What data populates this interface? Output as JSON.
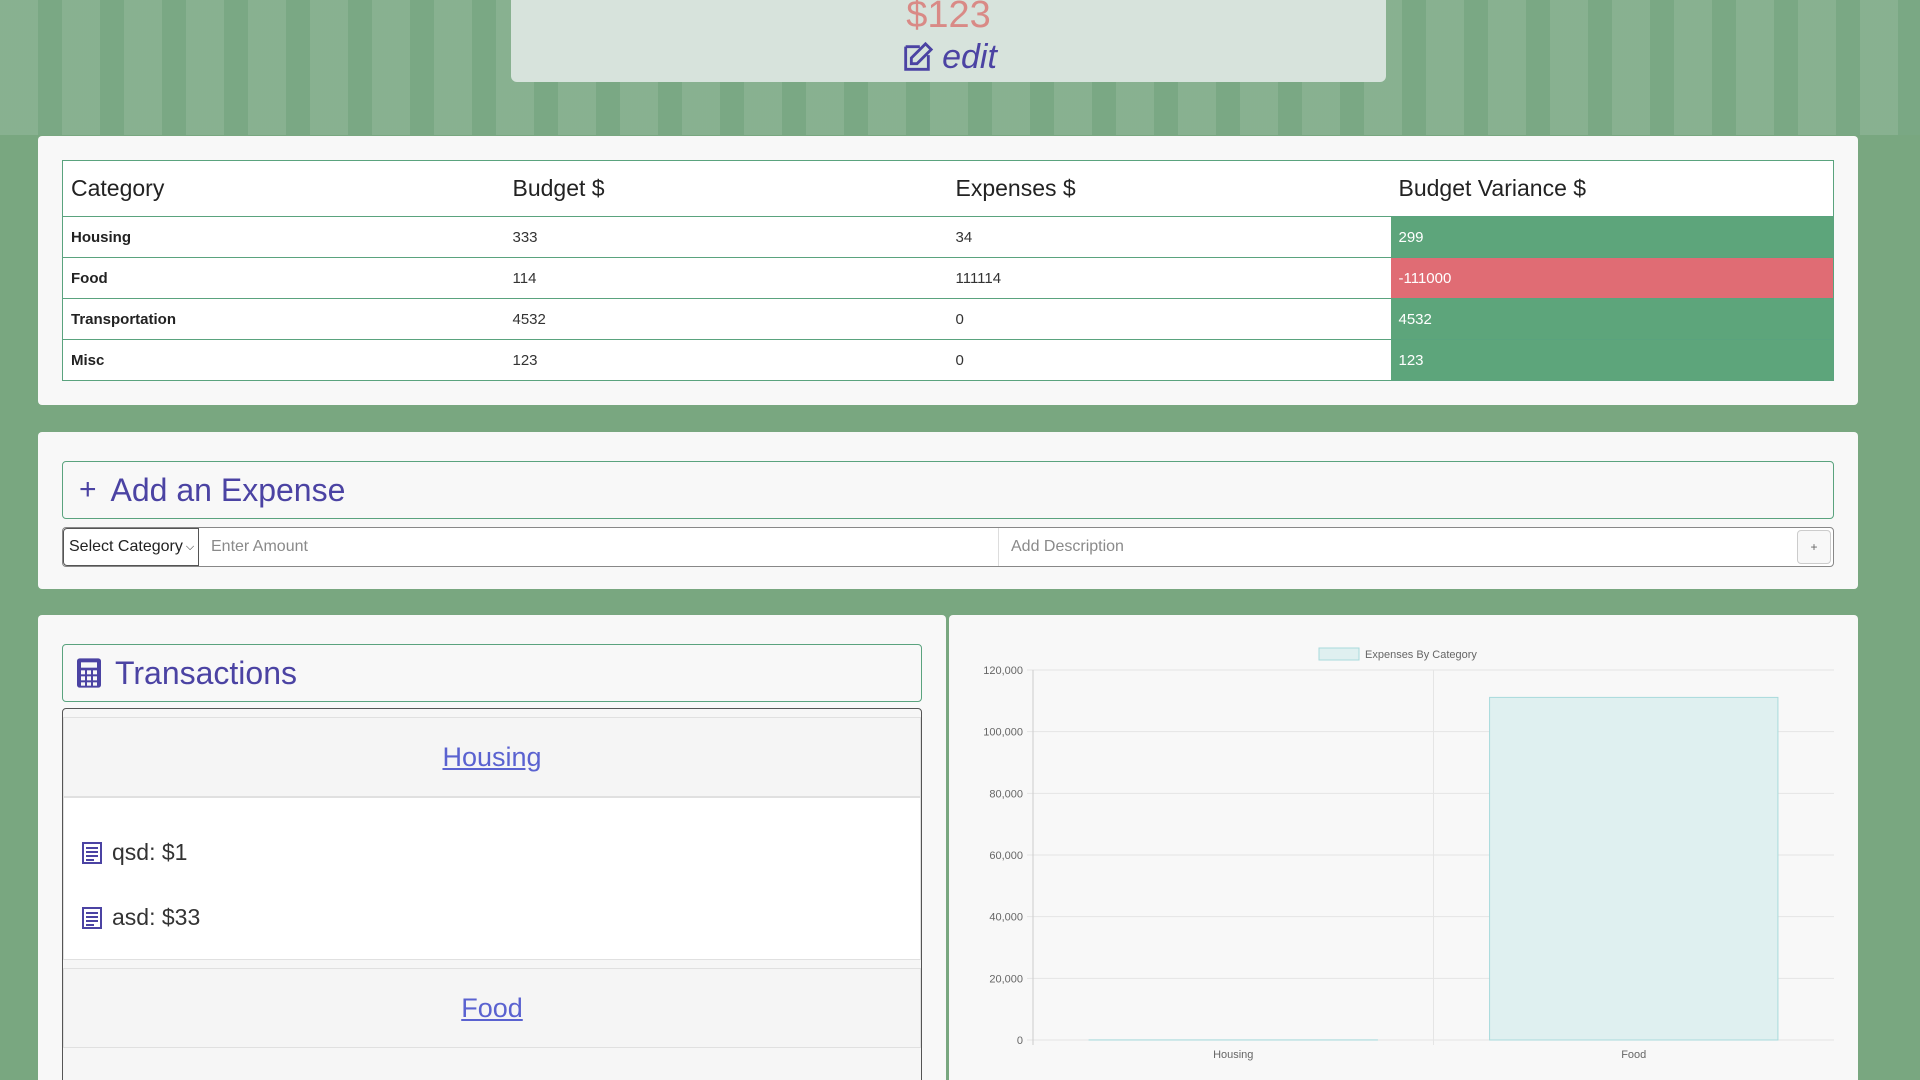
{
  "summary": {
    "budget_amount": "$123",
    "edit_label": "edit"
  },
  "budget_table": {
    "headers": [
      "Category",
      "Budget $",
      "Expenses $",
      "Budget Variance $"
    ],
    "rows": [
      {
        "category": "Housing",
        "budget": "333",
        "expenses": "34",
        "variance": "299",
        "status": "positive"
      },
      {
        "category": "Food",
        "budget": "114",
        "expenses": "111114",
        "variance": "-111000",
        "status": "negative"
      },
      {
        "category": "Transportation",
        "budget": "4532",
        "expenses": "0",
        "variance": "4532",
        "status": "positive"
      },
      {
        "category": "Misc",
        "budget": "123",
        "expenses": "0",
        "variance": "123",
        "status": "positive"
      }
    ]
  },
  "add_expense": {
    "title": "Add an Expense",
    "select_label": "Select Category",
    "amount_placeholder": "Enter Amount",
    "description_placeholder": "Add Description",
    "add_button": "+"
  },
  "transactions": {
    "title": "Transactions",
    "groups": [
      {
        "name": "Housing",
        "items": [
          "qsd: $1",
          "asd: $33"
        ]
      },
      {
        "name": "Food",
        "items": []
      }
    ]
  },
  "colors": {
    "positive": "#5da57b",
    "negative": "#e06c74",
    "accent": "#4b43a3",
    "background": "#79a780"
  },
  "chart_data": {
    "type": "bar",
    "legend": "Expenses By Category",
    "categories": [
      "Housing",
      "Food"
    ],
    "series": [
      {
        "name": "Expenses By Category",
        "values": [
          34,
          111114
        ]
      }
    ],
    "yticks": [
      "0",
      "20,000",
      "40,000",
      "60,000",
      "80,000",
      "100,000",
      "120,000"
    ],
    "ylim": [
      0,
      120000
    ],
    "grid": true,
    "legend_position": "top"
  }
}
